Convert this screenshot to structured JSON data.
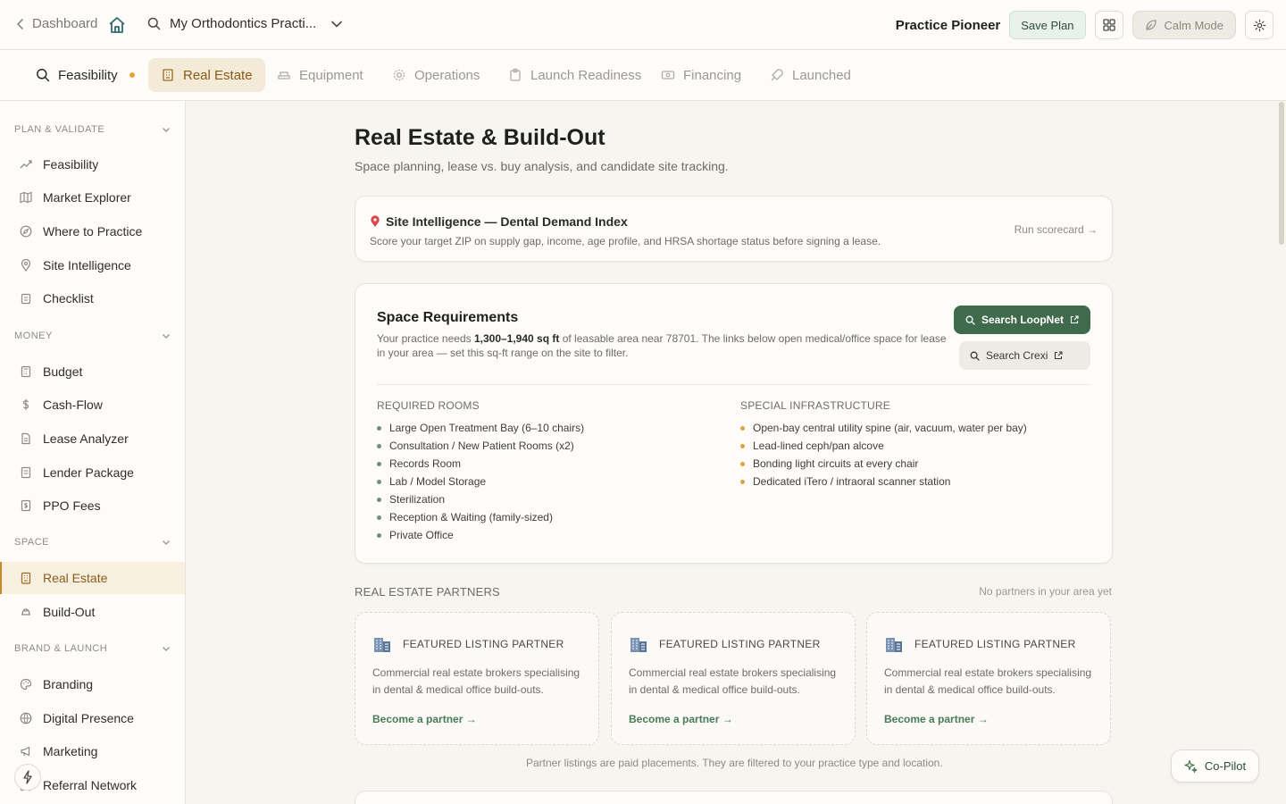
{
  "topbar": {
    "back_label": "Dashboard",
    "practice_name": "My Orthodontics Practi...",
    "brand": "Practice Pioneer",
    "save_label": "Save Plan",
    "calm_label": "Calm Mode"
  },
  "tabs": [
    {
      "label": "Feasibility",
      "icon": "search-icon"
    },
    {
      "label": "Real Estate",
      "icon": "building-icon"
    },
    {
      "label": "Equipment",
      "icon": "chair-icon"
    },
    {
      "label": "Operations",
      "icon": "gear-icon"
    },
    {
      "label": "Launch Readiness",
      "icon": "clipboard-icon"
    },
    {
      "label": "Financing",
      "icon": "money-icon"
    },
    {
      "label": "Launched",
      "icon": "rocket-icon"
    }
  ],
  "sidebar": {
    "sections": [
      {
        "title": "PLAN & VALIDATE",
        "items": [
          "Feasibility",
          "Market Explorer",
          "Where to Practice",
          "Site Intelligence",
          "Checklist"
        ]
      },
      {
        "title": "MONEY",
        "items": [
          "Budget",
          "Cash-Flow",
          "Lease Analyzer",
          "Lender Package",
          "PPO Fees"
        ]
      },
      {
        "title": "SPACE",
        "items": [
          "Real Estate",
          "Build-Out"
        ]
      },
      {
        "title": "BRAND & LAUNCH",
        "items": [
          "Branding",
          "Digital Presence",
          "Marketing",
          "Referral Network"
        ]
      }
    ],
    "active": "Real Estate"
  },
  "page": {
    "title": "Real Estate & Build-Out",
    "subtitle": "Space planning, lease vs. buy analysis, and candidate site tracking."
  },
  "site_intel": {
    "title": "Site Intelligence — Dental Demand Index",
    "desc": "Score your target ZIP on supply gap, income, age profile, and HRSA shortage status before signing a lease.",
    "run": "Run scorecard →"
  },
  "space": {
    "title": "Space Requirements",
    "desc_pre": "Your practice needs ",
    "desc_bold": "1,300–1,940 sq ft",
    "desc_post": " of leasable area near 78701. The links below open medical/office space for lease in your area — set this sq-ft range on the site to filter.",
    "loopnet": "Search LoopNet",
    "crexi": "Search Crexi",
    "required_head": "REQUIRED ROOMS",
    "required": [
      "Large Open Treatment Bay (6–10 chairs)",
      "Consultation / New Patient Rooms (x2)",
      "Records Room",
      "Lab / Model Storage",
      "Sterilization",
      "Reception & Waiting (family-sized)",
      "Private Office"
    ],
    "special_head": "SPECIAL INFRASTRUCTURE",
    "special": [
      "Open-bay central utility spine (air, vacuum, water per bay)",
      "Lead-lined ceph/pan alcove",
      "Bonding light circuits at every chair",
      "Dedicated iTero / intraoral scanner station"
    ]
  },
  "partners": {
    "head": "REAL ESTATE PARTNERS",
    "none": "No partners in your area yet",
    "cards": [
      {
        "title": "FEATURED LISTING PARTNER",
        "desc": "Commercial real estate brokers specialising in dental & medical office build-outs.",
        "link": "Become a partner →"
      },
      {
        "title": "FEATURED LISTING PARTNER",
        "desc": "Commercial real estate brokers specialising in dental & medical office build-outs.",
        "link": "Become a partner →"
      },
      {
        "title": "FEATURED LISTING PARTNER",
        "desc": "Commercial real estate brokers specialising in dental & medical office build-outs.",
        "link": "Become a partner →"
      }
    ],
    "fineprint": "Partner listings are paid placements. They are filtered to your practice type and location."
  },
  "copilot": "Co-Pilot",
  "colors": {
    "accent_green": "#3f6b4c",
    "accent_amber": "#e3a33a",
    "active_tab_bg": "#f4ead8"
  }
}
